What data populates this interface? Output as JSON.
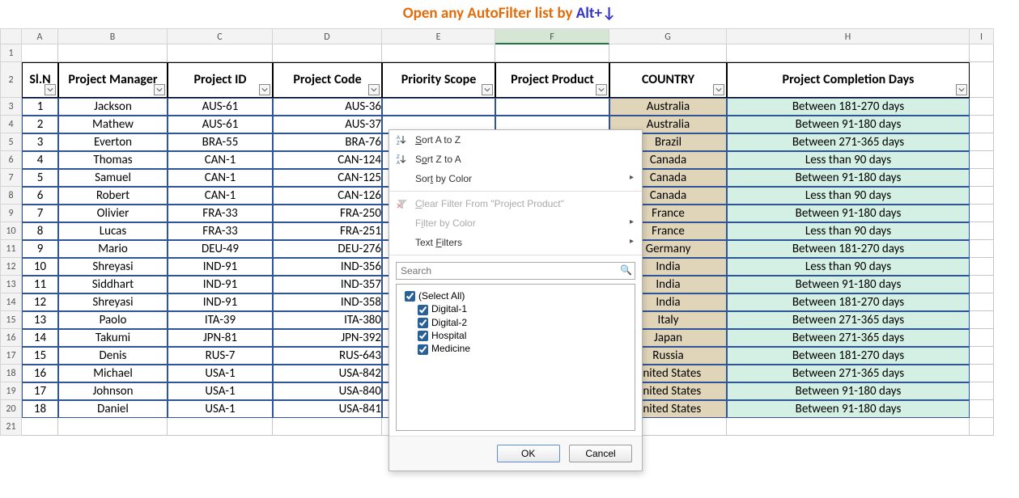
{
  "title": {
    "part1": "Open any AutoFilter list by ",
    "part2": "Alt+↓"
  },
  "columns": [
    {
      "letter": "",
      "w": "w-corner"
    },
    {
      "letter": "A",
      "w": "wA"
    },
    {
      "letter": "B",
      "w": "wB"
    },
    {
      "letter": "C",
      "w": "wC"
    },
    {
      "letter": "D",
      "w": "wD"
    },
    {
      "letter": "E",
      "w": "wE"
    },
    {
      "letter": "F",
      "w": "wF",
      "selected": true
    },
    {
      "letter": "G",
      "w": "wG"
    },
    {
      "letter": "H",
      "w": "wH"
    },
    {
      "letter": "I",
      "w": "wI"
    }
  ],
  "headers": [
    "Sl.N",
    "Project Manager",
    "Project ID",
    "Project Code",
    "Priority Scope",
    "Project Product",
    "COUNTRY",
    "Project Completion Days"
  ],
  "rows": [
    {
      "n": "1",
      "mgr": "Jackson",
      "pid": "AUS-61",
      "code": "AUS-36",
      "country": "Australia",
      "days": "Between 181-270 days"
    },
    {
      "n": "2",
      "mgr": "Mathew",
      "pid": "AUS-61",
      "code": "AUS-37",
      "country": "Australia",
      "days": "Between 91-180 days"
    },
    {
      "n": "3",
      "mgr": "Everton",
      "pid": "BRA-55",
      "code": "BRA-76",
      "country": "Brazil",
      "days": "Between 271-365 days"
    },
    {
      "n": "4",
      "mgr": "Thomas",
      "pid": "CAN-1",
      "code": "CAN-124",
      "country": "Canada",
      "days": "Less than 90 days"
    },
    {
      "n": "5",
      "mgr": "Samuel",
      "pid": "CAN-1",
      "code": "CAN-125",
      "country": "Canada",
      "days": "Between 91-180 days"
    },
    {
      "n": "6",
      "mgr": "Robert",
      "pid": "CAN-1",
      "code": "CAN-126",
      "country": "Canada",
      "days": "Less than 90 days"
    },
    {
      "n": "7",
      "mgr": "Olivier",
      "pid": "FRA-33",
      "code": "FRA-250",
      "country": "France",
      "days": "Between 91-180 days"
    },
    {
      "n": "8",
      "mgr": "Lucas",
      "pid": "FRA-33",
      "code": "FRA-251",
      "country": "France",
      "days": "Less than 90 days"
    },
    {
      "n": "9",
      "mgr": "Mario",
      "pid": "DEU-49",
      "code": "DEU-276",
      "country": "Germany",
      "days": "Between 181-270 days"
    },
    {
      "n": "10",
      "mgr": "Shreyasi",
      "pid": "IND-91",
      "code": "IND-356",
      "country": "India",
      "days": "Less than 90 days"
    },
    {
      "n": "11",
      "mgr": "Siddhart",
      "pid": "IND-91",
      "code": "IND-357",
      "country": "India",
      "days": "Between 91-180 days"
    },
    {
      "n": "12",
      "mgr": "Shreyasi",
      "pid": "IND-91",
      "code": "IND-358",
      "country": "India",
      "days": "Between 181-270 days"
    },
    {
      "n": "13",
      "mgr": "Paolo",
      "pid": "ITA-39",
      "code": "ITA-380",
      "country": "Italy",
      "days": "Between 271-365 days"
    },
    {
      "n": "14",
      "mgr": "Takumi",
      "pid": "JPN-81",
      "code": "JPN-392",
      "country": "Japan",
      "days": "Between 271-365 days"
    },
    {
      "n": "15",
      "mgr": "Denis",
      "pid": "RUS-7",
      "code": "RUS-643",
      "country": "Russia",
      "days": "Between 181-270 days"
    },
    {
      "n": "16",
      "mgr": "Michael",
      "pid": "USA-1",
      "code": "USA-842",
      "country": "United States",
      "days": "Between 271-365 days"
    },
    {
      "n": "17",
      "mgr": "Johnson",
      "pid": "USA-1",
      "code": "USA-840",
      "country": "United States",
      "days": "Between 91-180 days"
    },
    {
      "n": "18",
      "mgr": "Daniel",
      "pid": "USA-1",
      "code": "USA-841",
      "country": "United States",
      "days": "Between 91-180 days"
    }
  ],
  "dropdown": {
    "sort_az": "Sort A to Z",
    "sort_za": "Sort Z to A",
    "sort_color": "Sort by Color",
    "clear": "Clear Filter From \"Project Product\"",
    "filter_color": "Filter by Color",
    "text_filters": "Text Filters",
    "search_placeholder": "Search",
    "items": [
      "(Select All)",
      "Digital-1",
      "Digital-2",
      "Hospital",
      "Medicine"
    ],
    "ok": "OK",
    "cancel": "Cancel"
  }
}
